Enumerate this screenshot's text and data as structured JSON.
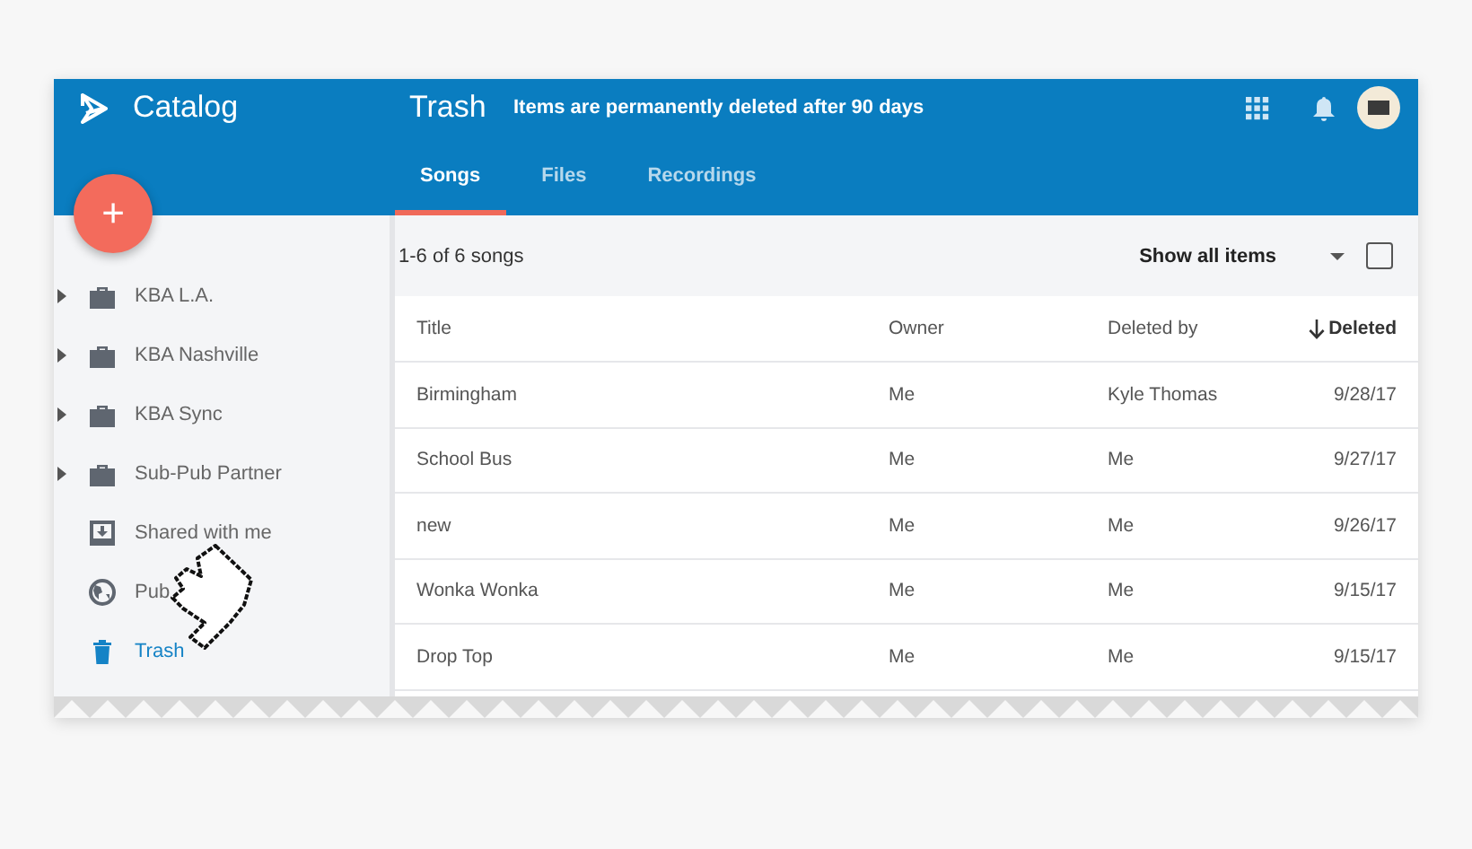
{
  "app": {
    "name": "Catalog"
  },
  "page": {
    "title": "Trash",
    "notice": "Items are permanently deleted after 90 days"
  },
  "tabs": [
    {
      "label": "Songs",
      "selected": true
    },
    {
      "label": "Files",
      "selected": false
    },
    {
      "label": "Recordings",
      "selected": false
    }
  ],
  "fab": {
    "label": "+"
  },
  "sidebar": {
    "items": [
      {
        "label": "KBA L.A.",
        "kind": "folder",
        "expandable": true,
        "selected": false
      },
      {
        "label": "KBA Nashville",
        "kind": "folder",
        "expandable": true,
        "selected": false
      },
      {
        "label": "KBA Sync",
        "kind": "folder",
        "expandable": true,
        "selected": false
      },
      {
        "label": "Sub-Pub Partner",
        "kind": "folder",
        "expandable": true,
        "selected": false
      },
      {
        "label": "Shared with me",
        "kind": "shared",
        "expandable": false,
        "selected": false
      },
      {
        "label": "Pub",
        "kind": "public",
        "expandable": false,
        "selected": false
      },
      {
        "label": "Trash",
        "kind": "trash",
        "expandable": false,
        "selected": true
      }
    ]
  },
  "toolbar": {
    "count": "1-6 of 6 songs",
    "filter": "Show all items",
    "select_all_checked": false
  },
  "table": {
    "columns": [
      {
        "label": "Title",
        "sorted": false
      },
      {
        "label": "Owner",
        "sorted": false
      },
      {
        "label": "Deleted by",
        "sorted": false
      },
      {
        "label": "Deleted",
        "sorted": true
      }
    ],
    "rows": [
      [
        "Birmingham",
        "Me",
        "Kyle Thomas",
        "9/28/17"
      ],
      [
        "School Bus",
        "Me",
        "Me",
        "9/27/17"
      ],
      [
        "new",
        "Me",
        "Me",
        "9/26/17"
      ],
      [
        "Wonka Wonka",
        "Me",
        "Me",
        "9/15/17"
      ],
      [
        "Drop Top",
        "Me",
        "Me",
        "9/15/17"
      ]
    ]
  }
}
